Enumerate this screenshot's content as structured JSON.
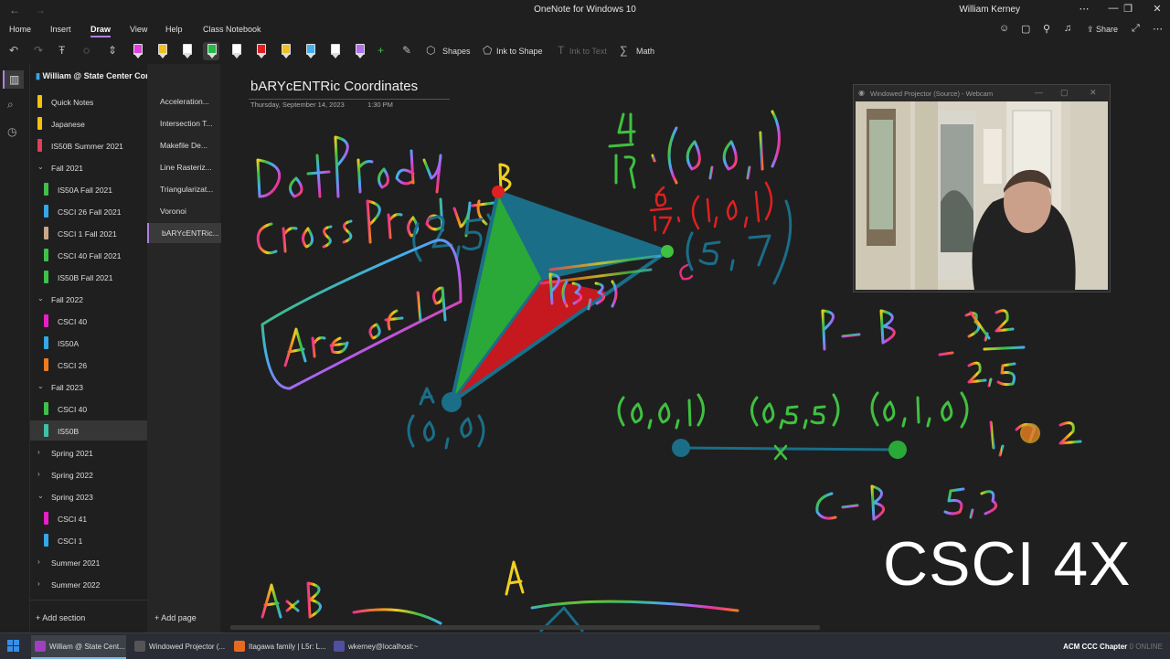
{
  "window": {
    "title": "OneNote for Windows 10",
    "user": "William Kerney"
  },
  "menu": [
    "Home",
    "Insert",
    "Draw",
    "View",
    "Help",
    "Class Notebook"
  ],
  "menu_active": "Draw",
  "share_label": "Share",
  "toolbar": {
    "shapes": "Shapes",
    "ink_to_shape": "Ink to Shape",
    "ink_to_text": "Ink to Text",
    "math": "Math"
  },
  "pen_colors": [
    "#e040e0",
    "#f0c020",
    "#ffffff",
    "#22bb44",
    "#ffffff",
    "#e02020",
    "#f0c020",
    "#40b0f0",
    "#ffffff",
    "#b070f0"
  ],
  "notebook": {
    "name": "William @ State Center Commun..."
  },
  "sections": [
    {
      "label": "Quick Notes",
      "color": "#f4c20d",
      "kind": "section"
    },
    {
      "label": "Japanese",
      "color": "#f4c20d",
      "kind": "section"
    },
    {
      "label": "IS50B Summer 2021",
      "color": "#e0405a",
      "kind": "section"
    },
    {
      "label": "Fall 2021",
      "kind": "group-open"
    },
    {
      "label": "IS50A Fall 2021",
      "color": "#3ec14a",
      "kind": "child"
    },
    {
      "label": "CSCI 26 Fall 2021",
      "color": "#35a7e8",
      "kind": "child"
    },
    {
      "label": "CSCI 1 Fall 2021",
      "color": "#c8a888",
      "kind": "child"
    },
    {
      "label": "CSCI 40 Fall 2021",
      "color": "#3ec14a",
      "kind": "child"
    },
    {
      "label": "IS50B Fall 2021",
      "color": "#3ec14a",
      "kind": "child"
    },
    {
      "label": "Fall 2022",
      "kind": "group-open"
    },
    {
      "label": "CSCI 40",
      "color": "#e81ec8",
      "kind": "child"
    },
    {
      "label": "IS50A",
      "color": "#35a7e8",
      "kind": "child"
    },
    {
      "label": "CSCI 26",
      "color": "#f07a20",
      "kind": "child"
    },
    {
      "label": "Fall 2023",
      "kind": "group-open"
    },
    {
      "label": "CSCI 40",
      "color": "#3ec14a",
      "kind": "child"
    },
    {
      "label": "IS50B",
      "color": "#3ec1a8",
      "kind": "child",
      "selected": true
    },
    {
      "label": "Spring 2021",
      "kind": "group-closed"
    },
    {
      "label": "Spring 2022",
      "kind": "group-closed"
    },
    {
      "label": "Spring 2023",
      "kind": "group-open"
    },
    {
      "label": "CSCI 41",
      "color": "#e81ec8",
      "kind": "child"
    },
    {
      "label": "CSCI 1",
      "color": "#35a7e8",
      "kind": "child"
    },
    {
      "label": "Summer 2021",
      "kind": "group-closed"
    },
    {
      "label": "Summer 2022",
      "kind": "group-closed"
    }
  ],
  "pages": [
    {
      "label": "Acceleration..."
    },
    {
      "label": "Intersection T..."
    },
    {
      "label": "Makefile De..."
    },
    {
      "label": "Line Rasteriz..."
    },
    {
      "label": "Triangularizat..."
    },
    {
      "label": "Voronoi"
    },
    {
      "label": "bARYcENTRic...",
      "selected": true
    }
  ],
  "add_section": "Add section",
  "add_page": "Add page",
  "page": {
    "title": "bARYcENTRic Coordinates",
    "date": "Thursday, September 14, 2023",
    "time": "1:30 PM"
  },
  "webcam": {
    "title": "Windowed Projector (Source) - Webcam"
  },
  "watermark": "CSCI 4X",
  "taskbar": [
    {
      "label": "William @ State Cent...",
      "color": "#a040c0",
      "active": true
    },
    {
      "label": "Windowed Projector (...",
      "color": "#555555"
    },
    {
      "label": "Itagawa family | L5r: L...",
      "color": "#e86a20"
    },
    {
      "label": "wkerney@localhost:~",
      "color": "#5050a0"
    }
  ],
  "tray": {
    "text": "ACM CCC Chapter",
    "status": "0 ONLINE"
  }
}
